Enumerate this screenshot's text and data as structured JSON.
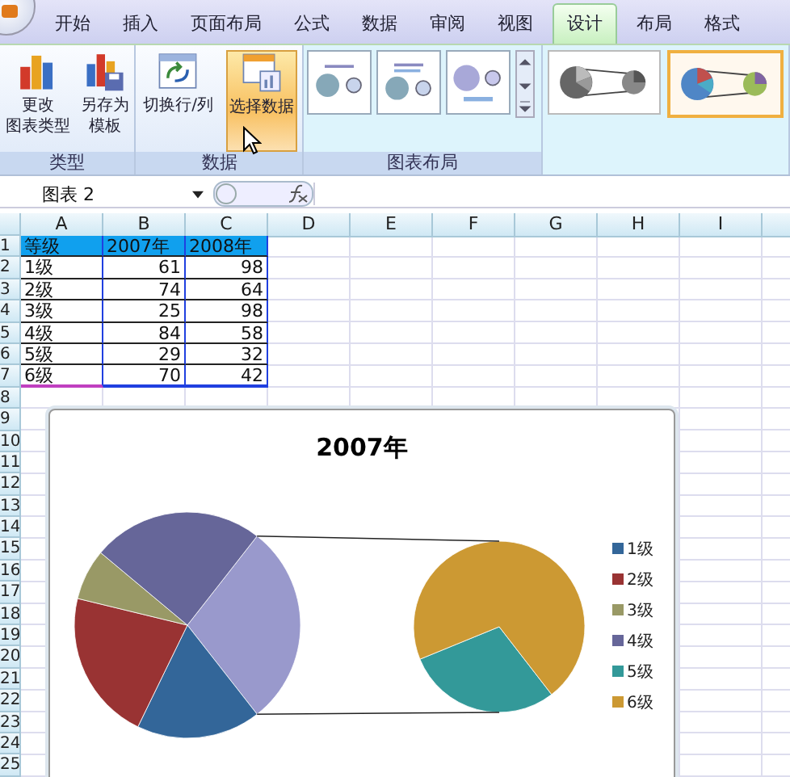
{
  "ribbon": {
    "tabs": [
      {
        "label": "开始",
        "selected": false
      },
      {
        "label": "插入",
        "selected": false
      },
      {
        "label": "页面布局",
        "selected": false
      },
      {
        "label": "公式",
        "selected": false
      },
      {
        "label": "数据",
        "selected": false
      },
      {
        "label": "审阅",
        "selected": false
      },
      {
        "label": "视图",
        "selected": false
      },
      {
        "label": "设计",
        "selected": true
      },
      {
        "label": "布局",
        "selected": false
      },
      {
        "label": "格式",
        "selected": false
      }
    ],
    "groups": [
      {
        "label": "类型",
        "buttons": [
          {
            "lines": [
              "更改",
              "图表类型"
            ],
            "kind": "change-type",
            "hover": false
          },
          {
            "lines": [
              "另存为",
              "模板"
            ],
            "kind": "save-template",
            "hover": false
          }
        ]
      },
      {
        "label": "数据",
        "buttons": [
          {
            "lines": [
              "切换行/列"
            ],
            "kind": "switch",
            "hover": false
          },
          {
            "lines": [
              "选择数据"
            ],
            "kind": "select-data",
            "hover": true
          }
        ]
      }
    ],
    "layout_group": {
      "label": "图表布局"
    },
    "styles": [
      {
        "selected": false,
        "colored": false
      },
      {
        "selected": true,
        "colored": true
      }
    ]
  },
  "formula_bar": {
    "name_box": "图表 2"
  },
  "sheet": {
    "columns": [
      "A",
      "B",
      "C",
      "D",
      "E",
      "F",
      "G",
      "H",
      "I"
    ],
    "row_numbers": [
      "1",
      "2",
      "3",
      "4",
      "5",
      "6",
      "7",
      "8",
      "9",
      "10",
      "11",
      "12",
      "13",
      "14",
      "15",
      "16",
      "17",
      "18",
      "19",
      "20",
      "21",
      "22",
      "23",
      "24",
      "25"
    ],
    "rows": [
      {
        "kind": "header",
        "cells": [
          "等级",
          "2007年",
          "2008年"
        ]
      },
      {
        "kind": "data",
        "cells": [
          "1级",
          "61",
          "98"
        ]
      },
      {
        "kind": "data",
        "cells": [
          "2级",
          "74",
          "64"
        ]
      },
      {
        "kind": "data",
        "cells": [
          "3级",
          "25",
          "98"
        ]
      },
      {
        "kind": "data",
        "cells": [
          "4级",
          "84",
          "58"
        ]
      },
      {
        "kind": "data",
        "cells": [
          "5级",
          "29",
          "32"
        ]
      },
      {
        "kind": "data",
        "cells": [
          "6级",
          "70",
          "42"
        ]
      }
    ]
  },
  "chart": {
    "title": "2007年",
    "legend": [
      {
        "label": "1级",
        "color": "#336699"
      },
      {
        "label": "2级",
        "color": "#993333"
      },
      {
        "label": "3级",
        "color": "#999966"
      },
      {
        "label": "4级",
        "color": "#666699"
      },
      {
        "label": "5级",
        "color": "#339999"
      },
      {
        "label": "6级",
        "color": "#cc9933"
      }
    ]
  }
}
